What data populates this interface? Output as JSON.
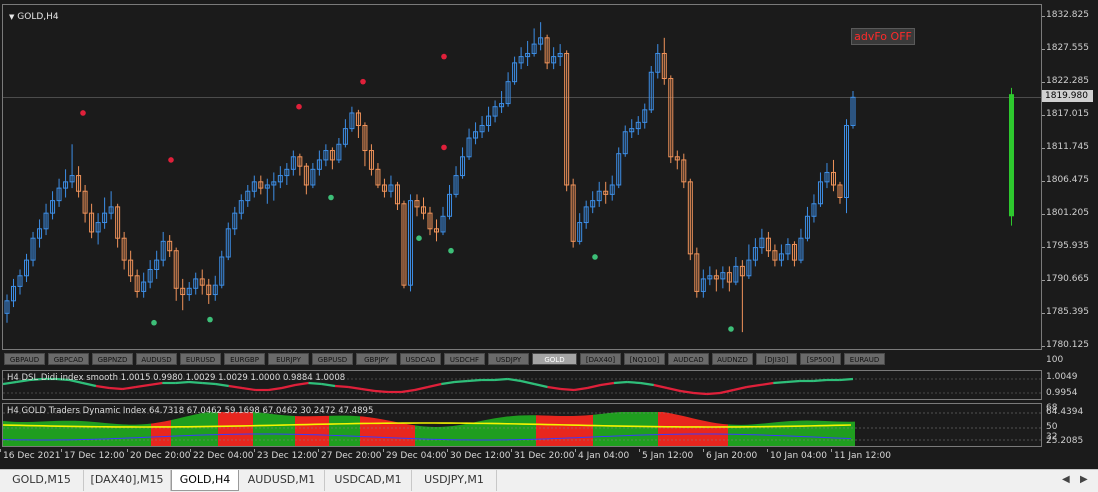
{
  "chart": {
    "title": "GOLD,H4",
    "advfo_label": "advFo OFF",
    "current_price": "1819.980",
    "price_axis": [
      "1832.825",
      "1827.555",
      "1822.285",
      "1817.015",
      "1811.745",
      "1806.475",
      "1801.205",
      "1795.935",
      "1790.665",
      "1785.395",
      "1780.125"
    ],
    "colors": {
      "bull": "#3d8ee6",
      "bear": "#f0935a",
      "dot_red": "#e0203a",
      "dot_green": "#3dbf78",
      "volume_bar": "#2ec92e"
    }
  },
  "symbols": [
    "GBPAUD",
    "GBPCAD",
    "GBPNZD",
    "AUDUSD",
    "EURUSD",
    "EURGBP",
    "EURJPY",
    "GBPUSD",
    "GBPJPY",
    "USDCAD",
    "USDCHF",
    "USDJPY",
    "GOLD",
    "[DAX40]",
    "[NQ100]",
    "AUDCAD",
    "AUDNZD",
    "[DJI30]",
    "[SP500]",
    "EURAUD"
  ],
  "active_symbol": "GOLD",
  "dsl": {
    "label": "H4 DSL Didi index smooth 1.0015 0.9980 1.0029 1.0029 1.0000 0.9884 1.0008",
    "axis_top": "100",
    "axis": [
      "1.0049",
      "0.9954"
    ]
  },
  "tdi": {
    "label": "H4 GOLD Traders Dynamic Index 64.7318 67.0462 59.1698 67.0462 30.2472 47.4895",
    "axis": [
      "68",
      "64.4394",
      "50",
      "32",
      "25.2085"
    ]
  },
  "time_axis": [
    "16 Dec 2021",
    "17 Dec 12:00",
    "20 Dec 20:00",
    "22 Dec 04:00",
    "23 Dec 12:00",
    "27 Dec 20:00",
    "29 Dec 04:00",
    "30 Dec 12:00",
    "31 Dec 20:00",
    "4 Jan 04:00",
    "5 Jan 12:00",
    "6 Jan 20:00",
    "10 Jan 04:00",
    "11 Jan 12:00"
  ],
  "tabs": [
    "GOLD,M15",
    "[DAX40],M15",
    "GOLD,H4",
    "AUDUSD,M1",
    "USDCAD,M1",
    "USDJPY,M1"
  ],
  "active_tab": "GOLD,H4",
  "candles": [
    [
      1785.5,
      1787.5,
      1784.0,
      1788.5
    ],
    [
      1787.5,
      1789.8,
      1786.5,
      1791.0
    ],
    [
      1789.8,
      1791.5,
      1788.5,
      1792.5
    ],
    [
      1791.5,
      1794.0,
      1790.5,
      1795.0
    ],
    [
      1794.0,
      1797.5,
      1793.0,
      1798.5
    ],
    [
      1797.5,
      1799.0,
      1796.0,
      1800.5
    ],
    [
      1799.0,
      1801.5,
      1798.0,
      1803.0
    ],
    [
      1801.5,
      1803.5,
      1800.5,
      1805.0
    ],
    [
      1803.5,
      1805.5,
      1802.5,
      1807.0
    ],
    [
      1805.5,
      1806.5,
      1804.0,
      1808.5
    ],
    [
      1806.5,
      1807.5,
      1805.5,
      1812.5
    ],
    [
      1807.5,
      1805.0,
      1804.0,
      1809.0
    ],
    [
      1805.0,
      1801.5,
      1800.0,
      1806.0
    ],
    [
      1801.5,
      1798.5,
      1797.5,
      1803.0
    ],
    [
      1798.5,
      1800.0,
      1796.5,
      1801.5
    ],
    [
      1800.0,
      1801.5,
      1799.0,
      1804.0
    ],
    [
      1801.5,
      1802.5,
      1800.5,
      1805.0
    ],
    [
      1802.5,
      1797.5,
      1796.0,
      1803.0
    ],
    [
      1797.5,
      1794.0,
      1792.5,
      1798.5
    ],
    [
      1794.0,
      1791.5,
      1790.5,
      1795.5
    ],
    [
      1791.5,
      1789.0,
      1788.0,
      1792.5
    ],
    [
      1789.0,
      1790.5,
      1788.0,
      1792.0
    ],
    [
      1790.5,
      1792.5,
      1789.5,
      1794.0
    ],
    [
      1792.5,
      1794.0,
      1791.0,
      1795.5
    ],
    [
      1794.0,
      1797.0,
      1793.0,
      1798.5
    ],
    [
      1797.0,
      1795.5,
      1794.5,
      1798.0
    ],
    [
      1795.5,
      1789.5,
      1787.5,
      1796.0
    ],
    [
      1789.5,
      1788.5,
      1786.0,
      1791.0
    ],
    [
      1788.5,
      1789.5,
      1787.5,
      1790.5
    ],
    [
      1789.5,
      1791.0,
      1788.5,
      1792.0
    ],
    [
      1791.0,
      1790.0,
      1788.5,
      1792.5
    ],
    [
      1790.0,
      1788.5,
      1787.0,
      1791.0
    ],
    [
      1788.5,
      1790.0,
      1787.5,
      1791.5
    ],
    [
      1790.0,
      1794.5,
      1789.5,
      1795.5
    ],
    [
      1794.5,
      1799.0,
      1794.0,
      1800.0
    ],
    [
      1799.0,
      1801.5,
      1798.0,
      1802.5
    ],
    [
      1801.5,
      1803.5,
      1800.5,
      1804.5
    ],
    [
      1803.5,
      1805.0,
      1802.5,
      1806.0
    ],
    [
      1805.0,
      1806.5,
      1804.0,
      1807.5
    ],
    [
      1806.5,
      1805.5,
      1804.5,
      1807.5
    ],
    [
      1805.5,
      1806.0,
      1803.0,
      1807.0
    ],
    [
      1806.0,
      1806.5,
      1803.5,
      1808.0
    ],
    [
      1806.5,
      1807.5,
      1805.5,
      1809.0
    ],
    [
      1807.5,
      1808.5,
      1806.0,
      1809.5
    ],
    [
      1808.5,
      1810.5,
      1807.5,
      1811.5
    ],
    [
      1810.5,
      1809.0,
      1807.5,
      1811.0
    ],
    [
      1809.0,
      1806.0,
      1804.5,
      1809.5
    ],
    [
      1806.0,
      1808.5,
      1805.5,
      1809.5
    ],
    [
      1808.5,
      1810.0,
      1807.5,
      1811.5
    ],
    [
      1810.0,
      1811.5,
      1809.0,
      1812.5
    ],
    [
      1811.5,
      1810.0,
      1808.5,
      1812.0
    ],
    [
      1810.0,
      1812.5,
      1809.5,
      1813.5
    ],
    [
      1812.5,
      1815.0,
      1812.0,
      1816.5
    ],
    [
      1815.0,
      1817.5,
      1814.5,
      1818.5
    ],
    [
      1817.5,
      1815.5,
      1813.5,
      1818.0
    ],
    [
      1815.5,
      1811.5,
      1809.0,
      1816.0
    ],
    [
      1811.5,
      1808.5,
      1807.5,
      1812.5
    ],
    [
      1808.5,
      1806.0,
      1805.5,
      1809.5
    ],
    [
      1806.0,
      1805.0,
      1804.0,
      1807.0
    ],
    [
      1805.0,
      1806.0,
      1804.0,
      1807.5
    ],
    [
      1806.0,
      1803.0,
      1802.0,
      1806.5
    ],
    [
      1803.0,
      1790.0,
      1789.5,
      1803.5
    ],
    [
      1790.0,
      1803.5,
      1789.0,
      1804.5
    ],
    [
      1803.5,
      1802.5,
      1801.0,
      1804.5
    ],
    [
      1802.5,
      1801.5,
      1800.5,
      1804.0
    ],
    [
      1801.5,
      1799.0,
      1798.0,
      1802.5
    ],
    [
      1799.0,
      1798.5,
      1797.0,
      1800.5
    ],
    [
      1798.5,
      1801.0,
      1798.0,
      1802.5
    ],
    [
      1801.0,
      1804.5,
      1800.5,
      1806.0
    ],
    [
      1804.5,
      1807.5,
      1804.0,
      1809.0
    ],
    [
      1807.5,
      1810.5,
      1807.0,
      1812.0
    ],
    [
      1810.5,
      1813.5,
      1810.0,
      1815.0
    ],
    [
      1813.5,
      1814.5,
      1812.5,
      1816.0
    ],
    [
      1814.5,
      1815.5,
      1813.5,
      1817.0
    ],
    [
      1815.5,
      1817.0,
      1814.5,
      1818.5
    ],
    [
      1817.0,
      1818.5,
      1816.0,
      1819.5
    ],
    [
      1818.5,
      1819.0,
      1817.5,
      1821.0
    ],
    [
      1819.0,
      1822.5,
      1818.5,
      1824.0
    ],
    [
      1822.5,
      1825.5,
      1822.0,
      1826.5
    ],
    [
      1825.5,
      1826.5,
      1824.5,
      1828.0
    ],
    [
      1826.5,
      1827.0,
      1825.0,
      1829.0
    ],
    [
      1827.0,
      1828.5,
      1826.5,
      1831.0
    ],
    [
      1828.5,
      1829.5,
      1827.5,
      1832.0
    ],
    [
      1829.5,
      1825.5,
      1824.5,
      1830.0
    ],
    [
      1825.5,
      1826.5,
      1824.5,
      1828.0
    ],
    [
      1826.5,
      1827.0,
      1825.0,
      1828.5
    ],
    [
      1827.0,
      1806.0,
      1805.0,
      1827.5
    ],
    [
      1806.0,
      1797.0,
      1796.0,
      1807.0
    ],
    [
      1797.0,
      1800.0,
      1796.5,
      1801.5
    ],
    [
      1800.0,
      1802.5,
      1799.0,
      1803.5
    ],
    [
      1802.5,
      1803.5,
      1801.5,
      1805.0
    ],
    [
      1803.5,
      1805.0,
      1802.5,
      1806.5
    ],
    [
      1805.0,
      1804.5,
      1803.0,
      1806.5
    ],
    [
      1804.5,
      1806.0,
      1803.5,
      1807.5
    ],
    [
      1806.0,
      1811.0,
      1805.5,
      1812.0
    ],
    [
      1811.0,
      1814.5,
      1810.5,
      1815.5
    ],
    [
      1814.5,
      1815.0,
      1813.5,
      1816.5
    ],
    [
      1815.0,
      1816.0,
      1814.0,
      1817.0
    ],
    [
      1816.0,
      1818.0,
      1815.0,
      1819.0
    ],
    [
      1818.0,
      1824.0,
      1817.5,
      1825.0
    ],
    [
      1824.0,
      1827.0,
      1823.0,
      1828.5
    ],
    [
      1827.0,
      1823.0,
      1822.0,
      1829.5
    ],
    [
      1823.0,
      1810.5,
      1809.5,
      1823.5
    ],
    [
      1810.5,
      1810.0,
      1808.5,
      1811.5
    ],
    [
      1810.0,
      1806.5,
      1805.5,
      1811.0
    ],
    [
      1806.5,
      1795.0,
      1794.0,
      1807.0
    ],
    [
      1795.0,
      1789.0,
      1788.0,
      1796.0
    ],
    [
      1789.0,
      1791.0,
      1788.0,
      1792.5
    ],
    [
      1791.0,
      1791.5,
      1790.0,
      1793.0
    ],
    [
      1791.5,
      1791.0,
      1789.0,
      1792.5
    ],
    [
      1791.0,
      1792.0,
      1789.5,
      1793.0
    ],
    [
      1792.0,
      1790.5,
      1789.0,
      1793.0
    ],
    [
      1790.5,
      1793.0,
      1790.0,
      1794.5
    ],
    [
      1793.0,
      1791.5,
      1782.5,
      1794.0
    ],
    [
      1791.5,
      1794.0,
      1791.0,
      1796.5
    ],
    [
      1794.0,
      1796.0,
      1793.0,
      1797.5
    ],
    [
      1796.0,
      1797.5,
      1795.0,
      1799.0
    ],
    [
      1797.5,
      1795.5,
      1794.5,
      1798.5
    ],
    [
      1795.5,
      1794.0,
      1793.0,
      1796.5
    ],
    [
      1794.0,
      1795.0,
      1793.0,
      1796.5
    ],
    [
      1795.0,
      1796.5,
      1794.0,
      1797.5
    ],
    [
      1796.5,
      1794.0,
      1793.0,
      1797.0
    ],
    [
      1794.0,
      1797.5,
      1793.5,
      1799.0
    ],
    [
      1797.5,
      1801.0,
      1797.0,
      1802.5
    ],
    [
      1801.0,
      1803.0,
      1800.0,
      1804.5
    ],
    [
      1803.0,
      1806.5,
      1802.5,
      1808.0
    ],
    [
      1806.5,
      1808.0,
      1805.5,
      1809.5
    ],
    [
      1808.0,
      1806.0,
      1805.0,
      1810.0
    ],
    [
      1806.0,
      1804.0,
      1803.0,
      1806.5
    ],
    [
      1804.0,
      1815.5,
      1801.5,
      1816.5
    ],
    [
      1815.5,
      1820.0,
      1815.0,
      1821.0
    ]
  ],
  "red_dots": [
    1817.5,
    1810.0,
    1818.5,
    1822.5,
    1826.5,
    1812.0
  ],
  "green_dots": [
    1784.0,
    1784.5,
    1804.0,
    1797.5,
    1795.5,
    1794.5,
    1783.0
  ]
}
